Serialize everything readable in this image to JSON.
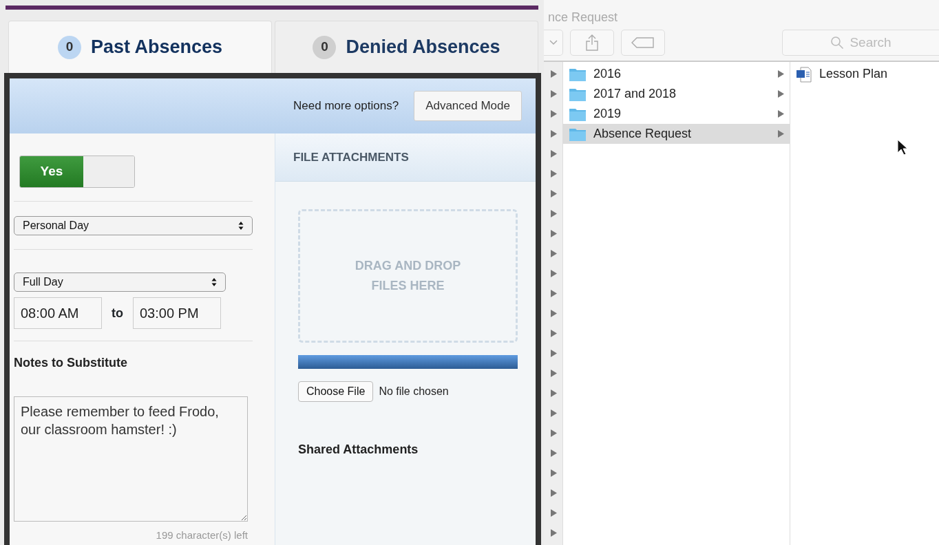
{
  "tabs": [
    {
      "count": "0",
      "label": "Past Absences",
      "selected": true
    },
    {
      "count": "0",
      "label": "Denied Absences",
      "selected": false
    }
  ],
  "header": {
    "prompt": "Need more options?",
    "button": "Advanced Mode"
  },
  "form": {
    "toggle": {
      "label": "Yes",
      "on": true
    },
    "reason": {
      "value": "Personal Day"
    },
    "duration": {
      "value": "Full Day"
    },
    "start_time": "08:00 AM",
    "separator": "to",
    "end_time": "03:00 PM",
    "notes_label": "Notes to Substitute",
    "notes": "Please remember to feed Frodo, our classroom hamster! :)",
    "counter": "199 character(s) left"
  },
  "attachments": {
    "title": "FILE ATTACHMENTS",
    "dropzone": "DRAG AND DROP FILES HERE",
    "upload": {
      "level": 1
    },
    "choose_button": "Choose File",
    "file_status": "No file chosen",
    "shared_title": "Shared Attachments"
  },
  "finder": {
    "title": "nce Request",
    "search": {
      "placeholder": "Search"
    },
    "folders": [
      {
        "name": "2016",
        "selected": false
      },
      {
        "name": "2017 and 2018",
        "selected": false
      },
      {
        "name": "2019",
        "selected": false
      },
      {
        "name": "Absence Request",
        "selected": true
      }
    ],
    "files": [
      {
        "name": "Lesson Plan"
      }
    ]
  }
}
